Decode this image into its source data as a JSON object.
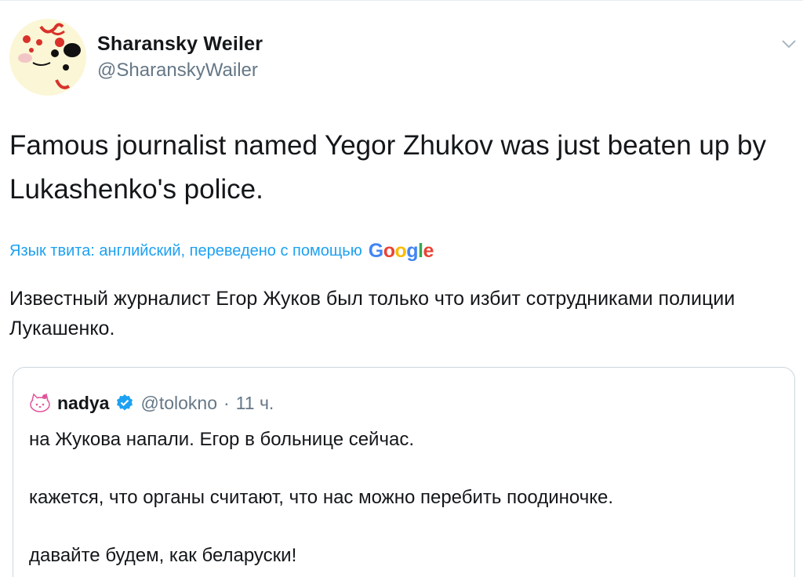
{
  "tweet": {
    "author": {
      "name": "Sharansky Weiler",
      "handle": "@SharanskyWailer"
    },
    "text": "Famous journalist named Yegor Zhukov was just beaten up by Lukashenko's police.",
    "translation": {
      "label": "Язык твита: английский, переведено с помощью",
      "provider": [
        "G",
        "o",
        "o",
        "g",
        "l",
        "e"
      ],
      "text": "Известный журналист Егор Жуков был только что избит сотрудниками полиции Лукашенко."
    }
  },
  "quote": {
    "name": "nadya",
    "handle": "@tolokno",
    "separator": "·",
    "time": "11 ч.",
    "lines": [
      "на Жукова напали. Егор в больнице сейчас.",
      "кажется, что органы считают, что нас можно перебить поодиночке.",
      "давайте будем, как беларуски!"
    ]
  },
  "icons": {
    "menu": "chevron-down-icon",
    "verified": "verified-badge-icon",
    "quote_avatar": "hello-kitty-icon"
  },
  "colors": {
    "link_blue": "#1da1f2",
    "secondary_text": "#657786",
    "border": "#ccd6dd"
  }
}
